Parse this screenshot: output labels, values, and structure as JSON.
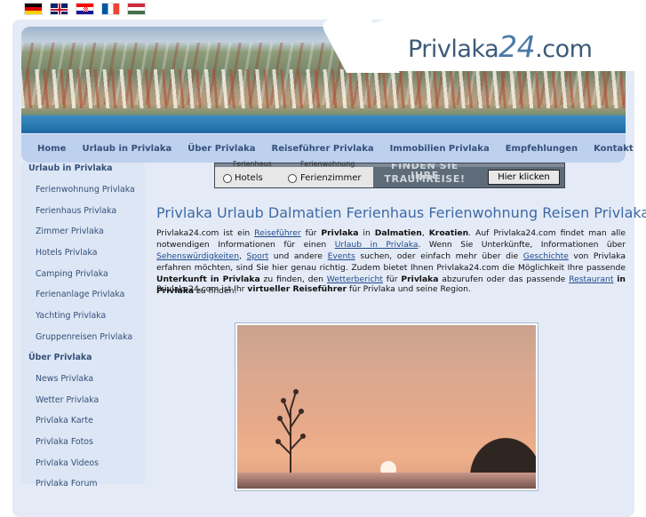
{
  "flags": [
    {
      "lang": "German",
      "icon": "flag-de-icon"
    },
    {
      "lang": "English",
      "icon": "flag-gb-icon"
    },
    {
      "lang": "Croatian",
      "icon": "flag-hr-icon"
    },
    {
      "lang": "French",
      "icon": "flag-fr-icon"
    },
    {
      "lang": "Hungarian",
      "icon": "flag-hu-icon"
    }
  ],
  "logo": {
    "prefix": "Privlaka",
    "number": "24",
    "suffix": ".com"
  },
  "nav": {
    "items": [
      "Home",
      "Urlaub in Privlaka",
      "Über Privlaka",
      "Reiseführer Privlaka",
      "Immobilien Privlaka",
      "Empfehlungen",
      "Kontakt"
    ]
  },
  "sidebar": {
    "groups": [
      {
        "heading": "Urlaub in Privlaka",
        "items": [
          "Ferienwohnung Privlaka",
          "Ferienhaus Privlaka",
          "Zimmer Privlaka",
          "Hotels Privlaka",
          "Camping Privlaka",
          "Ferienanlage Privlaka",
          "Yachting Privlaka",
          "Gruppenreisen Privlaka"
        ]
      },
      {
        "heading": "Über Privlaka",
        "items": [
          "News Privlaka",
          "Wetter Privlaka",
          "Privlaka Karte",
          "Privlaka Fotos",
          "Privlaka Videos",
          "Privlaka Forum"
        ]
      }
    ]
  },
  "promo": {
    "top_a": "Ferienhaus",
    "top_b": "Ferienwohnung",
    "option1": "Hotels",
    "option2": "Ferienzimmer",
    "slogan1": "FINDEN SIE IHRE",
    "slogan2": "TRAUMREISE!",
    "button": "Hier klicken"
  },
  "main": {
    "title": "Privlaka Urlaub Dalmatien Ferienhaus Ferienwohnung Reisen Privlaka",
    "p1": {
      "t1": "Privlaka24.com ist ein ",
      "l1": "Reiseführer",
      "t2": " für ",
      "b1": "Privlaka",
      "t3": " in ",
      "b2": "Dalmatien",
      "t4": ", ",
      "b3": "Kroatien",
      "t5": ". Auf Privlaka24.com findet man alle notwendigen Informationen für einen ",
      "l2": "Urlaub in Privlaka",
      "t6": ". Wenn Sie Unterkünfte, Informationen über ",
      "l3": "Sehenswürdigkeiten",
      "t7": ", ",
      "l4": "Sport",
      "t8": " und andere ",
      "l5": "Events",
      "t9": " suchen, oder einfach mehr über die ",
      "l6": "Geschichte",
      "t10": " von Privlaka erfahren möchten, sind Sie hier genau richtig. Zudem bietet Ihnen Privlaka24.com die Möglichkeit Ihre passende ",
      "b4": "Unterkunft in Privlaka",
      "t11": " zu finden, den ",
      "l7": "Wetterbericht",
      "t12": " für ",
      "b5": "Privlaka",
      "t13": " abzurufen oder das passende ",
      "l8": "Restaurant",
      "t14": " ",
      "b6": "in Privlaka",
      "t15": " zu finden."
    },
    "p2": {
      "t1": "Privlaka24.com ist Ihr ",
      "b1": "virtueller Reiseführer",
      "t2": " für Privlaka und seine Region."
    }
  }
}
